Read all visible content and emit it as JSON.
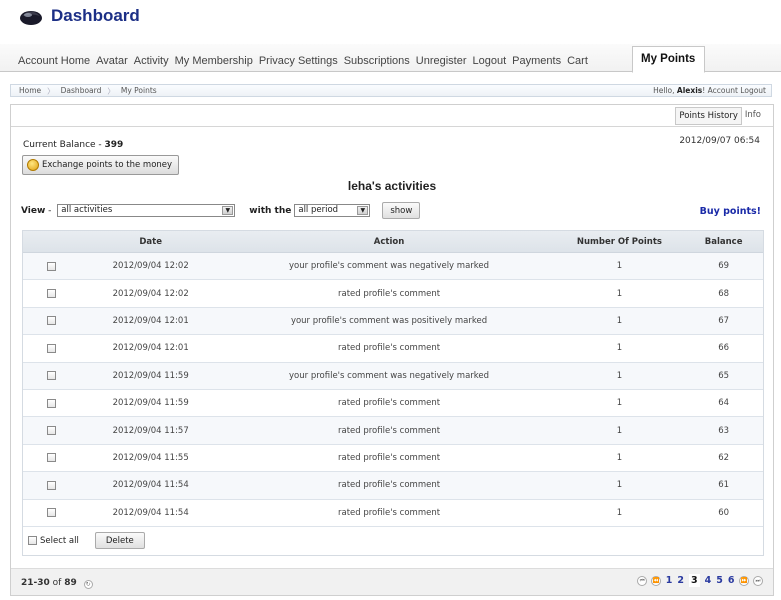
{
  "header": {
    "title": "Dashboard"
  },
  "nav": {
    "items": [
      "Account Home",
      "Avatar",
      "Activity",
      "My Membership",
      "Privacy Settings",
      "Subscriptions",
      "Unregister",
      "Logout",
      "Payments",
      "Cart"
    ],
    "active": "My Points"
  },
  "breadcrumb": {
    "items": [
      "Home",
      "Dashboard",
      "My Points"
    ],
    "greeting": "Hello,",
    "user": "Alexis",
    "greeting_suffix": "!",
    "account_logout": "Account Logout"
  },
  "tabs": {
    "history": "Points History",
    "info": "Info"
  },
  "balance": {
    "label": "Current Balance - ",
    "value": "399"
  },
  "datetime": "2012/09/07 06:54",
  "exchange_label": "Exchange points to the money",
  "activity_title": "leha's activities",
  "filter": {
    "view_label": "View",
    "view_dash": " - ",
    "view_value": "all activities",
    "with_label": "with the",
    "period_value": "all period",
    "show_label": "show"
  },
  "buy_link": "Buy points!",
  "table": {
    "columns": [
      "Date",
      "Action",
      "Number Of Points",
      "Balance"
    ],
    "rows": [
      {
        "date": "2012/09/04 12:02",
        "action": "your profile's comment was negatively marked",
        "points": "1",
        "balance": "69"
      },
      {
        "date": "2012/09/04 12:02",
        "action": "rated profile's comment",
        "points": "1",
        "balance": "68"
      },
      {
        "date": "2012/09/04 12:01",
        "action": "your profile's comment was positively marked",
        "points": "1",
        "balance": "67"
      },
      {
        "date": "2012/09/04 12:01",
        "action": "rated profile's comment",
        "points": "1",
        "balance": "66"
      },
      {
        "date": "2012/09/04 11:59",
        "action": "your profile's comment was negatively marked",
        "points": "1",
        "balance": "65"
      },
      {
        "date": "2012/09/04 11:59",
        "action": "rated profile's comment",
        "points": "1",
        "balance": "64"
      },
      {
        "date": "2012/09/04 11:57",
        "action": "rated profile's comment",
        "points": "1",
        "balance": "63"
      },
      {
        "date": "2012/09/04 11:55",
        "action": "rated profile's comment",
        "points": "1",
        "balance": "62"
      },
      {
        "date": "2012/09/04 11:54",
        "action": "rated profile's comment",
        "points": "1",
        "balance": "61"
      },
      {
        "date": "2012/09/04 11:54",
        "action": "rated profile's comment",
        "points": "1",
        "balance": "60"
      }
    ],
    "select_all": "Select all",
    "delete_label": "Delete"
  },
  "pager": {
    "range": "21-30",
    "of": " of ",
    "total": "89",
    "pages": [
      "1",
      "2",
      "3",
      "4",
      "5",
      "6"
    ],
    "current": "3"
  },
  "colors": {
    "brand": "#1c2f86",
    "link": "#1a2aa8"
  }
}
